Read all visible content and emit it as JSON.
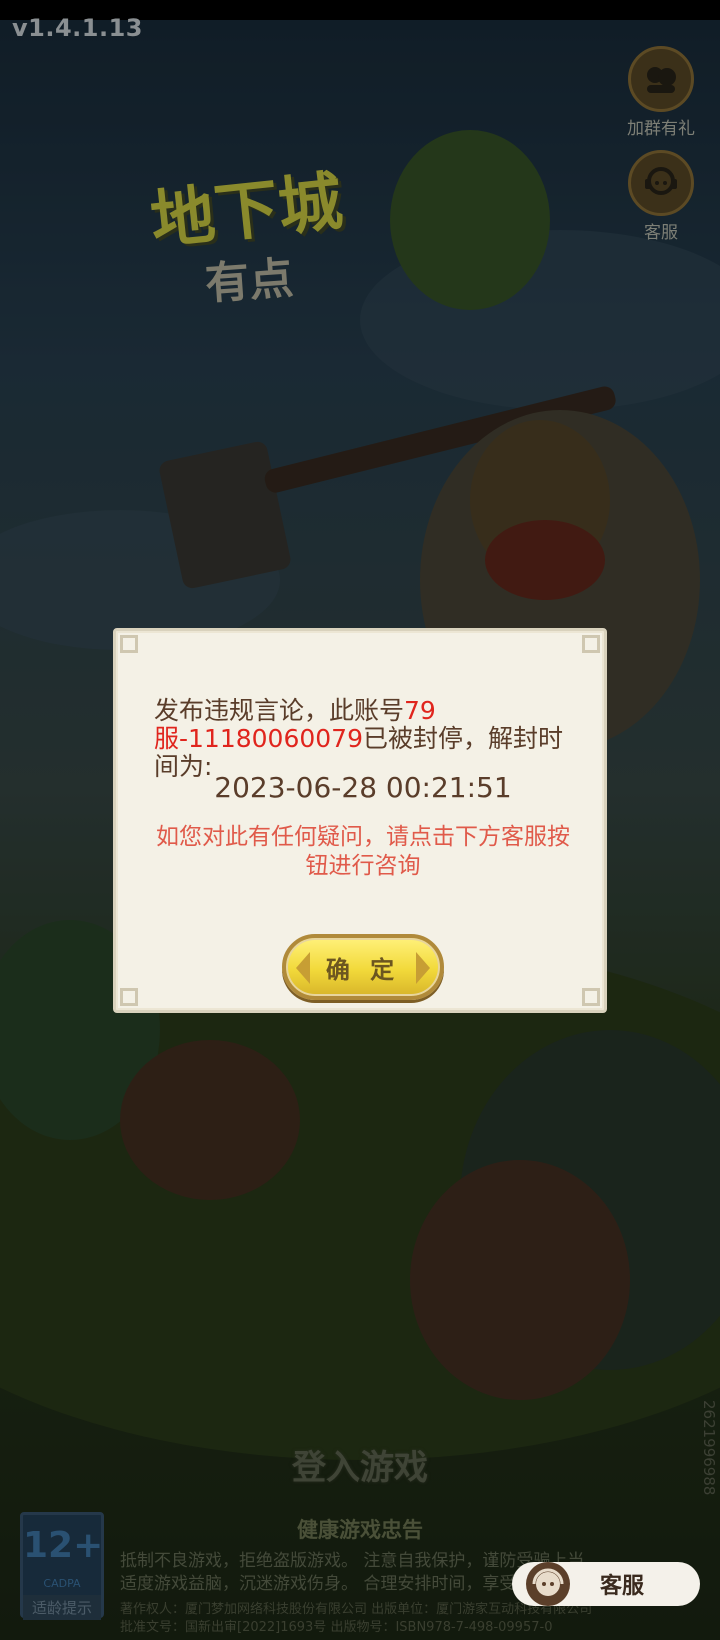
{
  "version": "v1.4.1.13",
  "side_buttons": [
    {
      "label": "加群有礼",
      "icon": "group-chat-icon"
    },
    {
      "label": "客服",
      "icon": "customer-service-icon"
    }
  ],
  "dialog": {
    "message_prefix": "发布违规言论，此账号",
    "account_id": "79服-11180060079",
    "message_suffix": "已被封停，解封时间为:",
    "unban_time": "2023-06-28 00:21:51",
    "hint": "如您对此有任何疑问，请点击下方客服按钮进行咨询",
    "confirm_label": "确 定"
  },
  "login_label": "登入游戏",
  "health_notice": {
    "title": "健康游戏忠告",
    "line1": "抵制不良游戏，拒绝盗版游戏。 注意自我保护，谨防受骗上当。",
    "line2": "适度游戏益脑，沉迷游戏伤身。 合理安排时间，享受健康生活。"
  },
  "copyright": {
    "line1": "著作权人：厦门梦加网络科技股份有限公司 出版单位：厦门游家互动科技有限公司",
    "line2": "批准文号：国新出审[2022]1693号 出版物号：ISBN978-7-498-09957-0"
  },
  "side_code": "2621996988",
  "age_rating": {
    "age": "12+",
    "org": "CADPA",
    "label": "适龄提示"
  },
  "customer_service_button": {
    "label": "客服",
    "icon": "customer-service-icon"
  },
  "colors": {
    "alert_red": "#e0251d",
    "hint_red": "#e05a4a",
    "dialog_bg": "#f4f1e6",
    "button_yellow": "#f2d93a"
  }
}
